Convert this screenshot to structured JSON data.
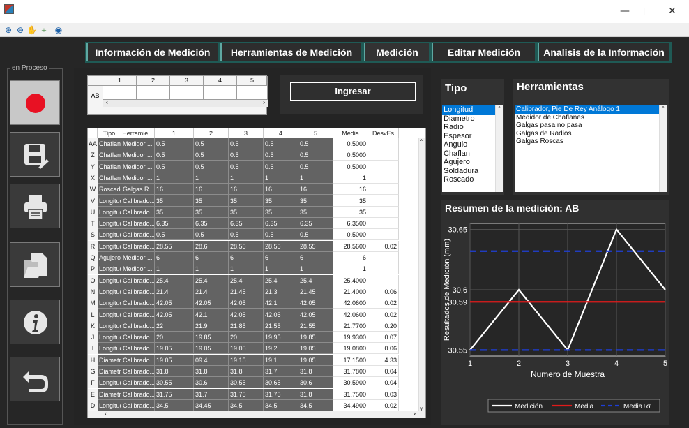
{
  "window": {
    "minimize": "—",
    "maximize": "□",
    "close": "✕"
  },
  "toolbar": {
    "icons": [
      "zoom-in-icon",
      "zoom-out-icon",
      "pan-icon",
      "data-cursor-icon",
      "help-icon"
    ]
  },
  "tabs": [
    {
      "label": "Información de Medición",
      "active": false
    },
    {
      "label": "Herramientas de Medición",
      "active": false
    },
    {
      "label": "Medición",
      "active": true
    },
    {
      "label": "Editar Medición",
      "active": false
    },
    {
      "label": "Analisis de la Información",
      "active": false
    }
  ],
  "sidebar": {
    "group_label": "en Proceso",
    "buttons": [
      "record-icon",
      "save-icon",
      "print-icon",
      "open-file-icon",
      "info-icon",
      "back-icon"
    ]
  },
  "top_grid": {
    "columns": [
      "1",
      "2",
      "3",
      "4",
      "5"
    ],
    "row_label": "AB"
  },
  "ingresar_label": "Ingresar",
  "table": {
    "columns": [
      "Tipo",
      "Herramie...",
      "1",
      "2",
      "3",
      "4",
      "5",
      "Media",
      "DesvEs"
    ],
    "rows": [
      [
        "AA",
        "Chaflan",
        "Medidor ...",
        "0.5",
        "0.5",
        "0.5",
        "0.5",
        "0.5",
        "0.5000",
        ""
      ],
      [
        "Z",
        "Chaflan",
        "Medidor ...",
        "0.5",
        "0.5",
        "0.5",
        "0.5",
        "0.5",
        "0.5000",
        ""
      ],
      [
        "Y",
        "Chaflan",
        "Medidor ...",
        "0.5",
        "0.5",
        "0.5",
        "0.5",
        "0.5",
        "0.5000",
        ""
      ],
      [
        "X",
        "Chaflan",
        "Medidor ...",
        "1",
        "1",
        "1",
        "1",
        "1",
        "1",
        ""
      ],
      [
        "W",
        "Roscado",
        "Galgas R...",
        "16",
        "16",
        "16",
        "16",
        "16",
        "16",
        ""
      ],
      [
        "V",
        "Longitud",
        "Calibrado...",
        "35",
        "35",
        "35",
        "35",
        "35",
        "35",
        ""
      ],
      [
        "U",
        "Longitud",
        "Calibrado...",
        "35",
        "35",
        "35",
        "35",
        "35",
        "35",
        ""
      ],
      [
        "T",
        "Longitud",
        "Calibrado...",
        "6.35",
        "6.35",
        "6.35",
        "6.35",
        "6.35",
        "6.3500",
        ""
      ],
      [
        "S",
        "Longitud",
        "Calibrado...",
        "0.5",
        "0.5",
        "0.5",
        "0.5",
        "0.5",
        "0.5000",
        ""
      ],
      [
        "R",
        "Longitud",
        "Calibrado...",
        "28.55",
        "28.6",
        "28.55",
        "28.55",
        "28.55",
        "28.5600",
        "0.02"
      ],
      [
        "Q",
        "Agujero",
        "Medidor ...",
        "6",
        "6",
        "6",
        "6",
        "6",
        "6",
        ""
      ],
      [
        "P",
        "Longitud",
        "Medidor ...",
        "1",
        "1",
        "1",
        "1",
        "1",
        "1",
        ""
      ],
      [
        "O",
        "Longitud",
        "Calibrado...",
        "25.4",
        "25.4",
        "25.4",
        "25.4",
        "25.4",
        "25.4000",
        ""
      ],
      [
        "N",
        "Longitud",
        "Calibrado...",
        "21.4",
        "21.4",
        "21.45",
        "21.3",
        "21.45",
        "21.4000",
        "0.06"
      ],
      [
        "M",
        "Longitud",
        "Calibrado...",
        "42.05",
        "42.05",
        "42.05",
        "42.1",
        "42.05",
        "42.0600",
        "0.02"
      ],
      [
        "L",
        "Longitud",
        "Calibrado...",
        "42.05",
        "42.1",
        "42.05",
        "42.05",
        "42.05",
        "42.0600",
        "0.02"
      ],
      [
        "K",
        "Longitud",
        "Calibrado...",
        "22",
        "21.9",
        "21.85",
        "21.55",
        "21.55",
        "21.7700",
        "0.20"
      ],
      [
        "J",
        "Longitud",
        "Calibrado...",
        "20",
        "19.85",
        "20",
        "19.95",
        "19.85",
        "19.9300",
        "0.07"
      ],
      [
        "I",
        "Longitud",
        "Calibrado...",
        "19.05",
        "19.05",
        "19.05",
        "19.2",
        "19.05",
        "19.0800",
        "0.06"
      ],
      [
        "H",
        "Diametro",
        "Calibrado...",
        "19.05",
        "09.4",
        "19.15",
        "19.1",
        "19.05",
        "17.1500",
        "4.33"
      ],
      [
        "G",
        "Diametro",
        "Calibrado...",
        "31.8",
        "31.8",
        "31.8",
        "31.7",
        "31.8",
        "31.7800",
        "0.04"
      ],
      [
        "F",
        "Longitud",
        "Calibrado...",
        "30.55",
        "30.6",
        "30.55",
        "30.65",
        "30.6",
        "30.5900",
        "0.04"
      ],
      [
        "E",
        "Diametro",
        "Calibrado...",
        "31.75",
        "31.7",
        "31.75",
        "31.75",
        "31.8",
        "31.7500",
        "0.03"
      ],
      [
        "D",
        "Longitud",
        "Calibrado...",
        "34.5",
        "34.45",
        "34.5",
        "34.5",
        "34.5",
        "34.4900",
        "0.02"
      ]
    ]
  },
  "tipo": {
    "title": "Tipo",
    "items": [
      "Longitud",
      "Diametro",
      "Radio",
      "Espesor",
      "Angulo",
      "Chaflan",
      "Agujero",
      "Soldadura",
      "Roscado"
    ],
    "selected": 0
  },
  "herramientas": {
    "title": "Herramientas",
    "items": [
      "Calibrador, Pie De Rey Análogo 1",
      "Medidor de Chaflanes",
      "Galgas pasa no pasa",
      "Galgas de Radios",
      "Galgas Roscas"
    ],
    "selected": 0
  },
  "chart_data": {
    "type": "line",
    "title": "Resumen de la medición: AB",
    "xlabel": "Numero de Muestra",
    "ylabel": "Resultados de Medición (mm)",
    "x": [
      1,
      2,
      3,
      4,
      5
    ],
    "xlim": [
      1,
      5
    ],
    "ylim": [
      0.545,
      0.655
    ],
    "xticks": [
      "1",
      "2",
      "3",
      "4",
      "5"
    ],
    "yticks": [
      {
        "value": 0.55,
        "label": "30.55"
      },
      {
        "value": 0.59,
        "label": "30.59"
      },
      {
        "value": 0.6,
        "label": "30.6"
      },
      {
        "value": 0.65,
        "label": "30.65"
      }
    ],
    "series": [
      {
        "name": "Medición",
        "values": [
          0.55,
          0.6,
          0.55,
          0.65,
          0.6
        ],
        "color": "#ffffff",
        "style": "solid"
      },
      {
        "name": "Media",
        "values": [
          0.59,
          0.59,
          0.59,
          0.59,
          0.59
        ],
        "color": "#e01b1b",
        "style": "solid"
      },
      {
        "name": "Media±σ",
        "values": [
          0.632,
          0.632,
          0.632,
          0.632,
          0.632
        ],
        "color": "#1f3fd6",
        "style": "dashed"
      },
      {
        "name": "Media±σ",
        "values": [
          0.55,
          0.55,
          0.55,
          0.55,
          0.55
        ],
        "color": "#1f3fd6",
        "style": "dashed"
      }
    ],
    "grid": true,
    "legend": "bottom",
    "legend_entries": [
      "Medición",
      "Media",
      "Media±σ"
    ]
  }
}
